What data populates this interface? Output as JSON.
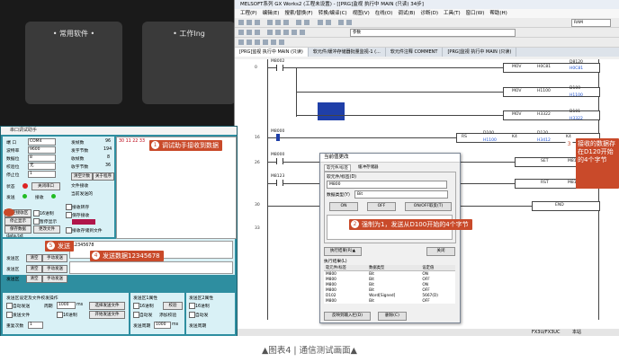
{
  "desktop": {
    "tile1": "• 常用软件 •",
    "tile2": "• 工作Ing"
  },
  "gx": {
    "title": "MELSOFT系列 GX Works2 (工程未设置) - [[PRG]监视 执行中 MAIN (只读) 34步]",
    "menus": [
      "工程(P)",
      "编辑(E)",
      "搜索/替换(F)",
      "转换/编译(C)",
      "视图(V)",
      "在线(O)",
      "调试(B)",
      "诊断(D)",
      "工具(T)",
      "窗口(W)",
      "帮助(H)"
    ],
    "toolbar_field": "参数",
    "tabs": [
      "[PRG]监视 执行中 MAIN (只读)",
      "软元件/缓冲存储器批量监视-1 (...",
      "软元件注释 COMMENT",
      "[PRG]监视 执行中 MAIN (只读)"
    ],
    "ladder": {
      "row0": "0",
      "row16": "16",
      "row26": "26",
      "row30": "30",
      "row33": "33",
      "m8002": "M8002",
      "m8000": "M8000",
      "m8000b": "M8000",
      "m8123": "M8123",
      "mov1": "MOV",
      "mov1_s": "H0C81",
      "mov1_d": "D8120",
      "mov1_dv": "H0C81",
      "mov2": "MOV",
      "mov2_s": "H1100",
      "mov2_d": "D100",
      "mov2_dv": "H1100",
      "mov3": "MOV",
      "mov3_s": "H3322",
      "mov3_d": "D101",
      "mov3_dv": "H3322",
      "rs": "RS",
      "rs_a": "D100",
      "rs_av": "H1100",
      "rs_b": "K4",
      "rs_c": "D120",
      "rs_cv": "H3412",
      "rs_d": "K4",
      "set": "SET",
      "set_d": "M8122",
      "rst": "RST",
      "rst_d": "M8123",
      "end": "END"
    },
    "status_left": "FX3U/FX3UC",
    "status_mid": "本站",
    "status_right": "RAM"
  },
  "modal": {
    "title": "当前值更改",
    "tab1": "软元件/标签",
    "tab2": "缓冲存储器",
    "label_device": "软元件/标签(D)",
    "device_value": "M800",
    "label_type": "数据类型(Y)",
    "type_value": "Bit",
    "btn_on": "ON",
    "btn_off": "OFF",
    "btn_onoff": "ON/OFF取反(T)",
    "history_btn": "执行结果(R)▲",
    "close_btn": "关闭",
    "result_label": "执行结果(L)",
    "col_dev": "软元件/标签",
    "col_type": "数据类型",
    "col_val": "设定值",
    "rows": [
      [
        "M800",
        "Bit",
        "ON"
      ],
      [
        "M800",
        "Bit",
        "OFF"
      ],
      [
        "M800",
        "Bit",
        "ON"
      ],
      [
        "M800",
        "Bit",
        "OFF"
      ],
      [
        "D102",
        "Word[Signed]",
        "5667(D)"
      ],
      [
        "M800",
        "Bit",
        "OFF"
      ]
    ],
    "btn_reflect": "反映到输入栏(D)",
    "btn_delete": "删除(C)"
  },
  "serial": {
    "title": "串口调试助手",
    "port_l": "端 口",
    "port_v": "COM4",
    "baud_l": "波特率",
    "baud_v": "9600",
    "data_l": "数据位",
    "data_v": "8",
    "parity_l": "校验位",
    "parity_v": "无",
    "stop_l": "停止位",
    "stop_v": "1",
    "status_l": "状态",
    "btn_close_port": "关闭串口",
    "send_l": "发送",
    "recv_l": "接收",
    "sent_l": "发帧数",
    "sent_v": "96",
    "sentb_l": "发字节数",
    "sentb_v": "194",
    "recvf_l": "收帧数",
    "recvf_v": "8",
    "recvb_l": "收字节数",
    "recvb_v": "36",
    "clear_count": "清空计数",
    "about": "关于程序",
    "file_recv": "文件接收",
    "data_link": "当前发送的",
    "recv_data": "30 11 22 33",
    "opt_recv": "接收转存",
    "opt_save": "保存接收",
    "opt_recv_file": "接收存储到文件",
    "opt_hex": "16进制",
    "opt_disp": "暂停显示",
    "opt_stop": "停止显示",
    "btn_clear": "清空接收区",
    "btn_save": "保存数据",
    "btn_change": "更改文件",
    "path": "data.txt",
    "send_label": "发送区",
    "send_data": "12345678",
    "btn_clear_send": "清空",
    "btn_manual_send": "手动发送",
    "btn_manual_send2": "手动发送",
    "btn_manual_send3": "手动发送",
    "auto_send_grp": "发送区设定及文件校发操作",
    "cycle_l": "周期",
    "cycle_v": "1000",
    "ms": "ms",
    "opt_auto": "自动发送",
    "opt_hex_send": "16进制",
    "opt_send_file": "发送文件",
    "btn_pick_file": "选择发送文件",
    "btn_send_file": "开始发送文件",
    "group2": "发送区1属性",
    "group3": "发送区2属性",
    "opt_hex2": "16进制",
    "btn_check": "校验",
    "opt_auto2": "自动发",
    "opt_add": "添加校验",
    "period2": "发送周期",
    "period2v": "1000",
    "ms2": "ms",
    "repeat_l": "重复次数",
    "repeat_v": "1"
  },
  "callouts": {
    "c1": "调试助手接收到数据",
    "c2": "强制为1，发送从D100开始的4个字节",
    "c3": "接收的数据存在D120开始的4个字节",
    "c4": "发送数据12345678",
    "c5": "发送",
    "n1": "1",
    "n2": "2",
    "n3": "3",
    "n4": "4",
    "n5": "5"
  },
  "caption": "▲图表4 | 通信测试画面▲"
}
